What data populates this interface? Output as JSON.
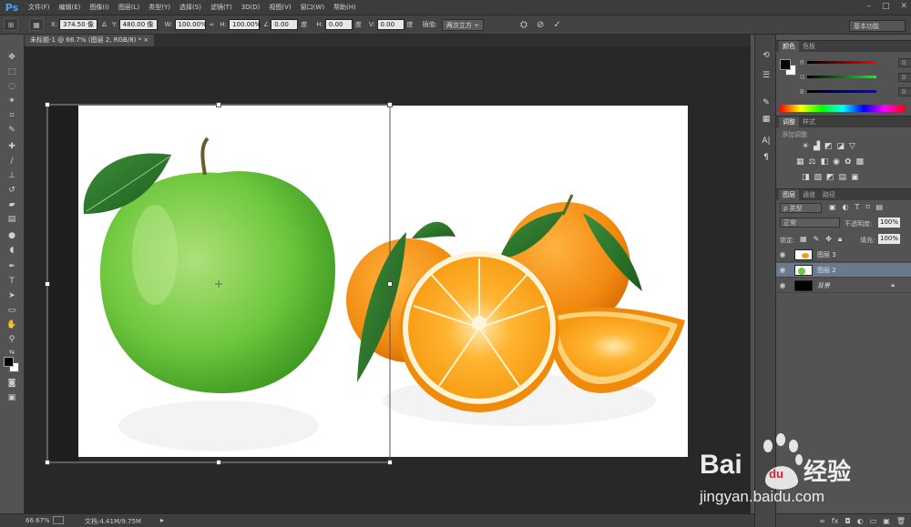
{
  "app": {
    "logo": "Ps"
  },
  "menu": [
    "文件(F)",
    "编辑(E)",
    "图像(I)",
    "图层(L)",
    "类型(Y)",
    "选择(S)",
    "滤镜(T)",
    "3D(D)",
    "视图(V)",
    "窗口(W)",
    "帮助(H)"
  ],
  "window_controls": {
    "min": "–",
    "max": "□",
    "close": "✕"
  },
  "options": {
    "x_label": "X:",
    "x_value": "374.50 像",
    "y_label": "Y:",
    "y_value": "480.00 像",
    "w_label": "W:",
    "w_value": "100.00%",
    "h_label": "H:",
    "h_value": "100.00%",
    "angle_value": "0.00",
    "angle_unit": "度",
    "hskew_label": "H:",
    "hskew_value": "0.00",
    "hskew_unit": "度",
    "vskew_label": "V:",
    "vskew_value": "0.00",
    "vskew_unit": "度",
    "interp_label": "插值:",
    "interp_value": "两次立方 ÷"
  },
  "workspace": "基本功能",
  "document_tab": "未标题-1 @ 66.7% (图层 2, RGB/8) *  ×",
  "status": {
    "zoom": "66.67%",
    "doc": "文档:4.41M/9.75M",
    "arrow": "▸"
  },
  "color_panel": {
    "tabs": [
      "颜色",
      "色板"
    ],
    "channels": [
      {
        "label": "R",
        "value": "0",
        "gradient_end": "#ff0000"
      },
      {
        "label": "G",
        "value": "0",
        "gradient_end": "#00ff00"
      },
      {
        "label": "B",
        "value": "0",
        "gradient_end": "#0000ff"
      }
    ]
  },
  "adjust_panel": {
    "tabs": [
      "调整",
      "样式"
    ],
    "add_label": "添加调整"
  },
  "layers_panel": {
    "tabs": [
      "图层",
      "通道",
      "路径"
    ],
    "kind_label": "ρ 类型",
    "blend_mode": "正常",
    "opacity_label": "不透明度:",
    "opacity_value": "100%",
    "lock_label": "锁定:",
    "fill_label": "填充:",
    "fill_value": "100%",
    "layers": [
      {
        "name": "图层 3",
        "selected": false,
        "thumb": "orange"
      },
      {
        "name": "图层 2",
        "selected": true,
        "thumb": "apple"
      },
      {
        "name": "背景",
        "selected": false,
        "thumb": "black",
        "locked": true
      }
    ]
  },
  "watermark": {
    "brand": "Bai",
    "brand2": "du",
    "cn": "经验",
    "url": "jingyan.baidu.com"
  }
}
